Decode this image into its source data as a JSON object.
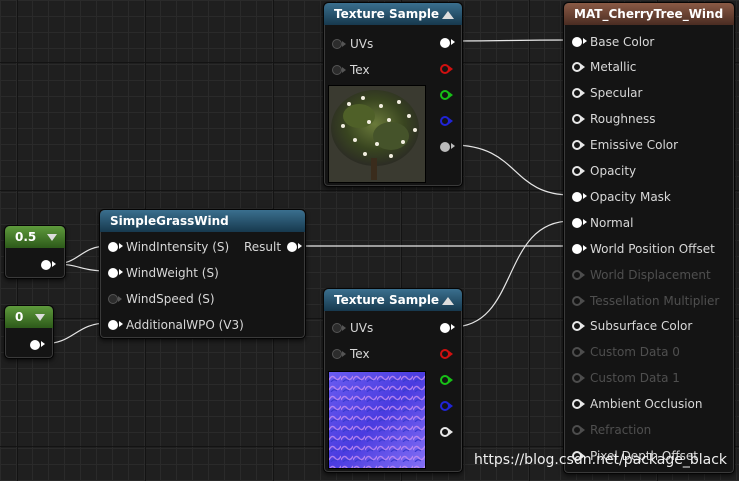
{
  "nodes": {
    "texture_sample_top": {
      "title": "Texture Sample",
      "inputs": [
        "UVs",
        "Tex"
      ]
    },
    "material": {
      "title": "MAT_CherryTree_Wind",
      "pins": [
        {
          "label": "Base Color",
          "state": "connected"
        },
        {
          "label": "Metallic",
          "state": "active"
        },
        {
          "label": "Specular",
          "state": "active"
        },
        {
          "label": "Roughness",
          "state": "active"
        },
        {
          "label": "Emissive Color",
          "state": "active"
        },
        {
          "label": "Opacity",
          "state": "active"
        },
        {
          "label": "Opacity Mask",
          "state": "connected"
        },
        {
          "label": "Normal",
          "state": "connected"
        },
        {
          "label": "World Position Offset",
          "state": "connected"
        },
        {
          "label": "World Displacement",
          "state": "disabled"
        },
        {
          "label": "Tessellation Multiplier",
          "state": "disabled"
        },
        {
          "label": "Subsurface Color",
          "state": "active"
        },
        {
          "label": "Custom Data 0",
          "state": "disabled"
        },
        {
          "label": "Custom Data 1",
          "state": "disabled"
        },
        {
          "label": "Ambient Occlusion",
          "state": "active"
        },
        {
          "label": "Refraction",
          "state": "disabled"
        },
        {
          "label": "Pixel Depth Offset",
          "state": "active"
        }
      ]
    },
    "simple_grass_wind": {
      "title": "SimpleGrassWind",
      "inputs": [
        "WindIntensity (S)",
        "WindWeight (S)",
        "WindSpeed (S)",
        "AdditionalWPO (V3)"
      ],
      "output": "Result"
    },
    "constant_a": {
      "value": "0.5"
    },
    "constant_b": {
      "value": "0"
    },
    "texture_sample_bottom": {
      "title": "Texture Sample",
      "inputs": [
        "UVs",
        "Tex"
      ]
    }
  },
  "colors": {
    "header_texture": "#17394e",
    "header_material": "#4a2c22",
    "header_constant": "#2d5a1a",
    "pin_red": "#d01010",
    "pin_green": "#17c017",
    "pin_blue": "#2024d6"
  },
  "watermark": "https://blog.csdn.net/package_black"
}
